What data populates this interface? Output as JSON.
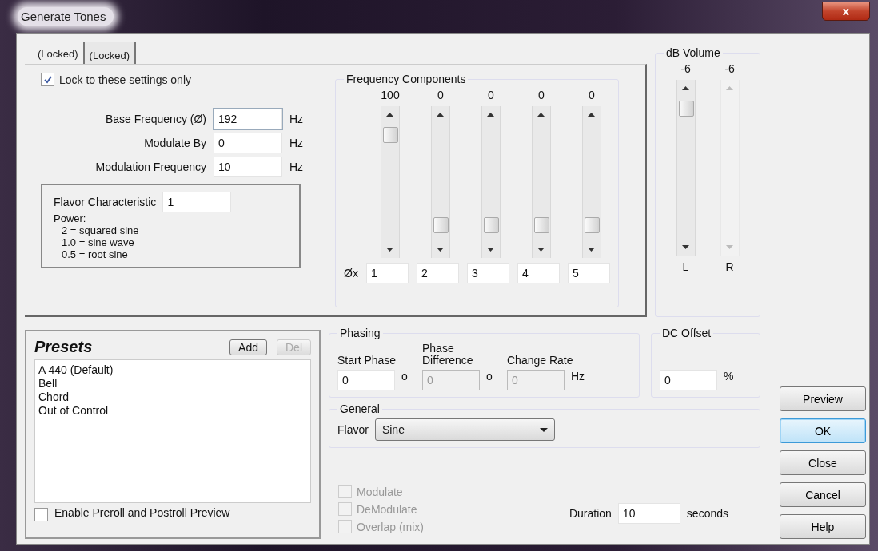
{
  "window": {
    "title": "Generate Tones",
    "close_label": "x"
  },
  "tabs": [
    {
      "label": "(Locked)",
      "selected": true
    },
    {
      "label": "(Locked)",
      "selected": false
    }
  ],
  "lock": {
    "label": "Lock to these settings only",
    "checked": true
  },
  "fields": [
    {
      "label": "Base Frequency (Ø)",
      "value": "192",
      "unit": "Hz",
      "focused": true
    },
    {
      "label": "Modulate By",
      "value": "0",
      "unit": "Hz",
      "focused": false
    },
    {
      "label": "Modulation Frequency",
      "value": "10",
      "unit": "Hz",
      "focused": false
    }
  ],
  "flavor_box": {
    "label": "Flavor Characteristic",
    "value": "1",
    "notes": [
      "Power:",
      "2 = squared sine",
      "1.0 = sine wave",
      "0.5 = root sine"
    ]
  },
  "frequency_components": {
    "title": "Frequency Components",
    "multiplier_label": "Øx",
    "sliders": [
      {
        "reading": "100",
        "level": 0.85,
        "multiple": "1"
      },
      {
        "reading": "0",
        "level": 0.18,
        "multiple": "2"
      },
      {
        "reading": "0",
        "level": 0.18,
        "multiple": "3"
      },
      {
        "reading": "0",
        "level": 0.18,
        "multiple": "4"
      },
      {
        "reading": "0",
        "level": 0.18,
        "multiple": "5"
      }
    ]
  },
  "volume": {
    "title": "dB Volume",
    "channels": [
      {
        "reading": "-6",
        "label": "L",
        "disabled": false,
        "level": 0.87
      },
      {
        "reading": "-6",
        "label": "R",
        "disabled": true
      }
    ]
  },
  "presets": {
    "title": "Presets",
    "add": "Add",
    "del": "Del",
    "del_disabled": true,
    "items": [
      "A 440 (Default)",
      "Bell",
      "Chord",
      "Out of Control"
    ],
    "preroll": {
      "label": "Enable Preroll and Postroll Preview",
      "checked": false
    }
  },
  "phasing": {
    "title": "Phasing",
    "fields": [
      {
        "label": "Start Phase",
        "value": "0",
        "unit": "o",
        "disabled": false
      },
      {
        "label": "Phase Difference",
        "value": "0",
        "unit": "o",
        "disabled": true
      },
      {
        "label": "Change Rate",
        "value": "0",
        "unit": "Hz",
        "disabled": true
      }
    ]
  },
  "dc_offset": {
    "title": "DC Offset",
    "value": "0",
    "unit": "%"
  },
  "general": {
    "title": "General",
    "flavor_label": "Flavor",
    "flavor_value": "Sine"
  },
  "options": [
    {
      "label": "Modulate",
      "checked": false,
      "disabled": true
    },
    {
      "label": "DeModulate",
      "checked": false,
      "disabled": true
    },
    {
      "label": "Overlap (mix)",
      "checked": false,
      "disabled": true
    }
  ],
  "duration": {
    "label": "Duration",
    "value": "10",
    "unit": "seconds"
  },
  "buttons": [
    {
      "label": "Preview",
      "default": false
    },
    {
      "label": "OK",
      "default": true
    },
    {
      "label": "Close",
      "default": false
    },
    {
      "label": "Cancel",
      "default": false
    },
    {
      "label": "Help",
      "default": false
    }
  ]
}
